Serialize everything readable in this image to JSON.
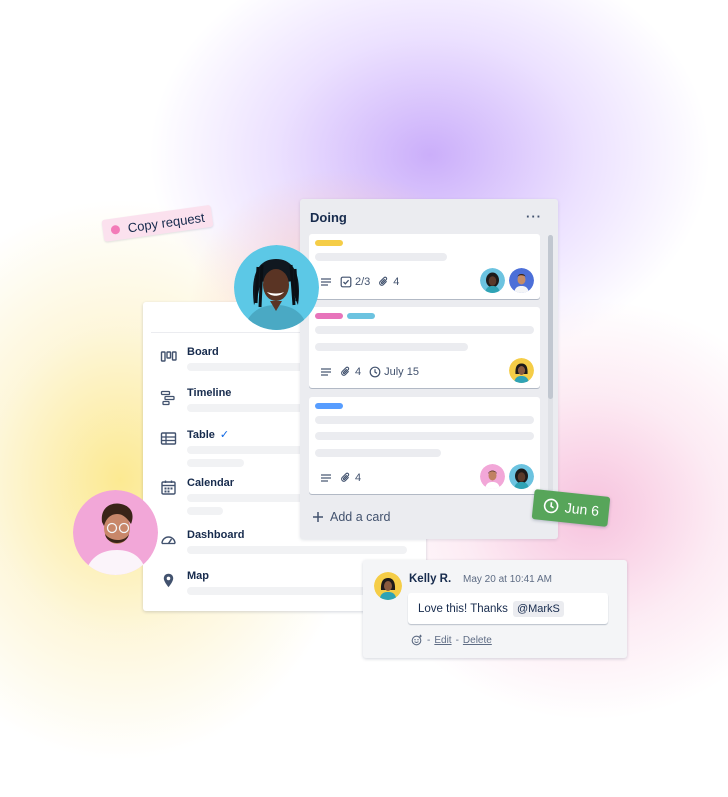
{
  "views": {
    "items": [
      {
        "label": "Board",
        "icon": "board-icon"
      },
      {
        "label": "Timeline",
        "icon": "timeline-icon"
      },
      {
        "label": "Table",
        "icon": "table-icon",
        "checked": true
      },
      {
        "label": "Calendar",
        "icon": "calendar-icon"
      },
      {
        "label": "Dashboard",
        "icon": "dashboard-icon"
      },
      {
        "label": "Map",
        "icon": "map-pin-icon"
      }
    ],
    "checkmark": "✓"
  },
  "list": {
    "title": "Doing",
    "menu": "···",
    "add_card_label": "Add a card",
    "cards": [
      {
        "labels": [
          "#f5cd47"
        ],
        "checklist": "2/3",
        "attachments": "4",
        "members": [
          "member-a",
          "member-b"
        ]
      },
      {
        "labels": [
          "#e774bb",
          "#6cc3e0"
        ],
        "attachments": "4",
        "due": "July 15",
        "members": [
          "member-c"
        ]
      },
      {
        "labels": [
          "#579dff"
        ],
        "attachments": "4",
        "members": [
          "member-d",
          "member-a"
        ]
      }
    ]
  },
  "sticker": {
    "text": "Copy request",
    "color": "#f37ab8"
  },
  "date_badge": {
    "text": "Jun 6",
    "color": "#57a55a"
  },
  "comment": {
    "author": "Kelly R.",
    "timestamp": "May 20 at 10:41 AM",
    "text": "Love this! Thanks",
    "mention": "@MarkS",
    "sep1": "-",
    "edit": "Edit",
    "sep2": "-",
    "delete": "Delete"
  },
  "colors": {
    "accent": "#0c66e4",
    "list_bg": "#ebecf0"
  }
}
